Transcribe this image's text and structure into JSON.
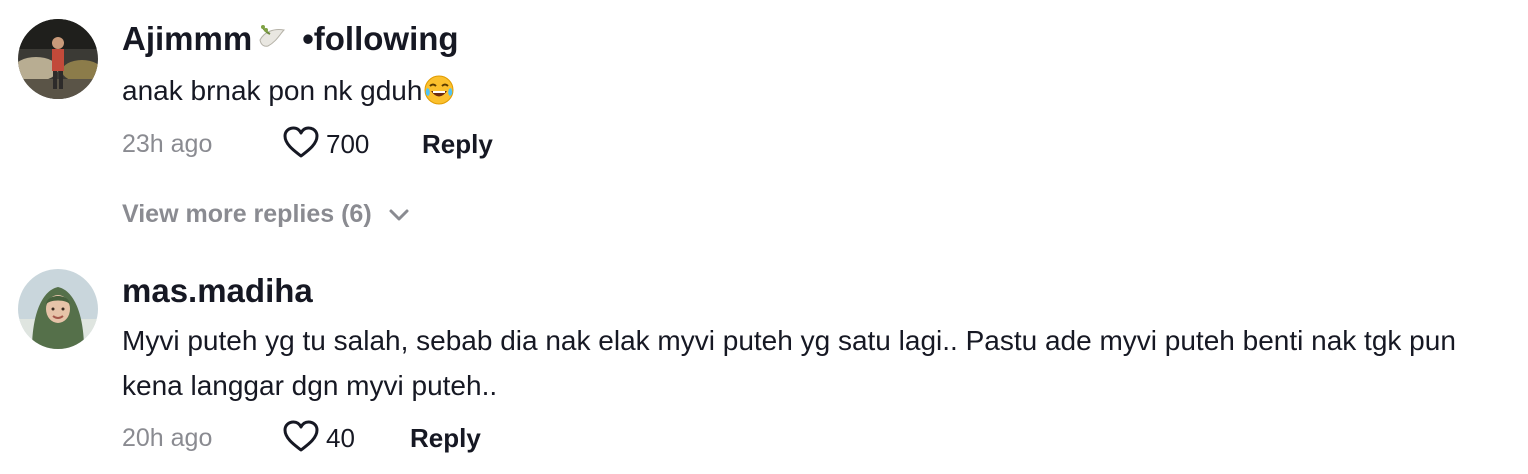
{
  "comments": [
    {
      "username": "Ajimmm",
      "username_suffix": "•following",
      "text": "anak brnak pon nk gduh",
      "time": "23h ago",
      "likes": "700",
      "reply_label": "Reply",
      "view_more": "View more replies (6)"
    },
    {
      "username": "mas.madiha",
      "text": "Myvi puteh yg tu salah, sebab dia nak elak myvi puteh yg satu lagi.. Pastu ade myvi puteh benti nak tgk pun kena langgar dgn myvi puteh..",
      "time": "20h ago",
      "likes": "40",
      "reply_label": "Reply"
    }
  ],
  "icons": {
    "like": "heart-outline-icon",
    "expand": "chevron-down-icon",
    "emoji": "face-with-tears-of-joy-emoji",
    "username_emoji": "dove-emoji"
  },
  "colors": {
    "primary_text": "#161823",
    "secondary_text": "#8a8b91"
  }
}
